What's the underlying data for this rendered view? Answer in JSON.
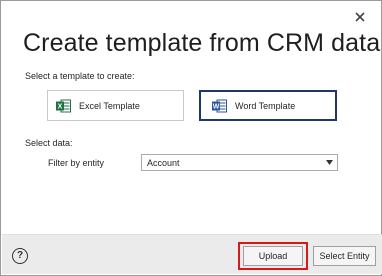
{
  "dialog": {
    "title": "Create template from CRM data",
    "close_icon": "close-icon"
  },
  "template_section": {
    "label": "Select a template to create:",
    "options": [
      {
        "label": "Excel Template",
        "icon": "excel-icon",
        "selected": false
      },
      {
        "label": "Word Template",
        "icon": "word-icon",
        "selected": true
      }
    ]
  },
  "data_section": {
    "label": "Select data:",
    "filter_label": "Filter by entity",
    "entity_value": "Account"
  },
  "footer": {
    "help_icon": "help-icon",
    "help_glyph": "?",
    "upload_label": "Upload",
    "select_entity_label": "Select Entity"
  },
  "colors": {
    "excel_green": "#207245",
    "word_blue": "#2b579a",
    "selected_border": "#1f3864",
    "highlight_red": "#d7191c",
    "footer_bg": "#ebebeb"
  }
}
